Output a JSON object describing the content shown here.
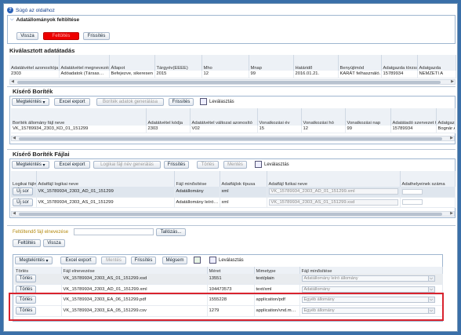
{
  "help_link": "Súgó az oldalhoz",
  "header_panel": {
    "title": "Adatállományok feltöltése",
    "back_label": "Vissza",
    "upload_label": "Feltöltés",
    "refresh_label": "Frissítés"
  },
  "kivalasztott": {
    "title": "Kiválasztott adatátadás",
    "columns": [
      "Adatátvétel azonosítója",
      "Adatátvétel megnevezése",
      "Állapot",
      "Tárgyév(EEEE)",
      "Mho",
      "Mnap",
      "Határidő",
      "Benyújtmód",
      "Adatgazda törzsszáma",
      "Adatgazda"
    ],
    "row": [
      "2303",
      "Adóadatok (Társas…",
      "Befejezve, sikeresen",
      "2015",
      "12",
      "99",
      "2016.01.21.",
      "KARÁT felhasználó…",
      "15789934",
      "NEMZETI A"
    ]
  },
  "kisero": {
    "title": "Kísérő Boríték",
    "toolbar": {
      "view": "Megtekintés",
      "excel": "Excel export",
      "generate": "Boríték adatok generálása",
      "refresh": "Frissítés",
      "detach": "Leválasztás"
    },
    "columns": [
      "Boríték állomány fájl neve",
      "Adatátvétel kódja",
      "Adatátvétel változat azonosító",
      "Vonatkozási év",
      "Vonatkozási hó",
      "Vonatkozási nap",
      "Adatátadó szervezet törzsszám",
      "Adatgazda kapcsolattart"
    ],
    "row": [
      "VK_15789934_2303_KD_01_151299",
      "2303",
      "V02",
      "15",
      "12",
      "99",
      "15789934",
      "Bognár Andr"
    ]
  },
  "fajlai": {
    "title": "Kísérő Boríték Fájlai",
    "toolbar": {
      "view": "Megtekintés",
      "excel": "Excel export",
      "generate": "Logikai fájl név generálás",
      "refresh": "Frissítés",
      "delete": "Törlés",
      "save": "Mentés",
      "detach": "Leválasztás"
    },
    "columns": [
      "Logikai fájlnév másolása",
      "Adatfájl logikai neve",
      "Fájl minősítése",
      "Adatfájlok típusa",
      "Adatfájl fizikai neve",
      "Adathelyeinek száma"
    ],
    "rows": [
      {
        "copy": "Új sor",
        "logical": "VK_15789934_2303_AD_01_151299",
        "qual": "Adatállomány",
        "type": "xml",
        "physical": "VK_15789934_2303_AD_01_151299.xml"
      },
      {
        "copy": "Új sor",
        "logical": "VK_15789934_2303_AS_01_151299",
        "qual": "Adatállomány leíró…",
        "type": "xml",
        "physical": "VK_15789934_2303_AS_01_151299.xsd"
      }
    ]
  },
  "upload": {
    "label": "Feltöltendő fájl elnevezése",
    "browse": "Tallózás...",
    "upload_btn": "Feltöltés",
    "back_btn": "Vissza"
  },
  "files": {
    "toolbar": {
      "view": "Megtekintés",
      "excel": "Excel export",
      "save": "Mentés",
      "refresh": "Frissítés",
      "cancel": "Mégsem",
      "detach": "Leválasztás"
    },
    "columns": [
      "Törlés",
      "Fájl elnevezése",
      "Méret",
      "Mimetype",
      "Fájl minősítése"
    ],
    "rows": [
      {
        "del": "Törlés",
        "name": "VK_15789934_2303_AS_01_151299.xsd",
        "size": "13551",
        "mime": "text/plain",
        "qual": "Adatállomány leíró állomány"
      },
      {
        "del": "Törlés",
        "name": "VK_15789934_2303_AD_01_151299.xml",
        "size": "104473573",
        "mime": "text/xml",
        "qual": "Adatállomány"
      },
      {
        "del": "Törlés",
        "name": "VK_15789934_2303_EA_06_151299.pdf",
        "size": "1555228",
        "mime": "application/pdf",
        "qual": "Egyéb állomány"
      },
      {
        "del": "Törlés",
        "name": "VK_15789934_2303_EA_05_151299.csv",
        "size": "1279",
        "mime": "application/vnd.m…",
        "qual": "Egyéb állomány"
      }
    ]
  },
  "colors": {
    "accent": "#2a62b8",
    "highlight": "#d9232e",
    "upload_red": "#ee0000"
  }
}
